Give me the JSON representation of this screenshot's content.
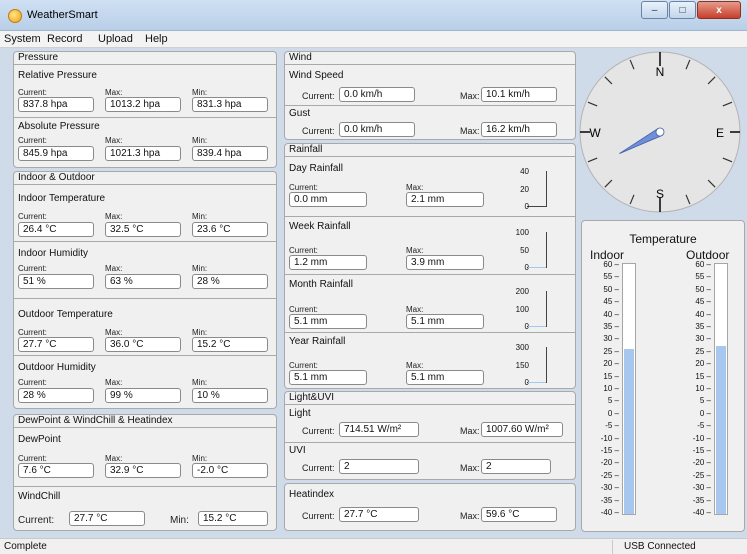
{
  "window": {
    "title": "WeatherSmart",
    "minimize": "–",
    "maximize": "□",
    "close": "x"
  },
  "menu": [
    "System",
    "Record",
    "Upload",
    "Help"
  ],
  "labels": {
    "current": "Current:",
    "max": "Max:",
    "min": "Min:"
  },
  "pressure": {
    "title": "Pressure",
    "relative": {
      "title": "Relative Pressure",
      "current": "837.8 hpa",
      "max": "1013.2 hpa",
      "min": "831.3 hpa"
    },
    "absolute": {
      "title": "Absolute Pressure",
      "current": "845.9 hpa",
      "max": "1021.3 hpa",
      "min": "839.4 hpa"
    }
  },
  "indoor_outdoor": {
    "title": "Indoor & Outdoor",
    "indoor_temp": {
      "title": "Indoor Temperature",
      "current": "26.4 °C",
      "max": "32.5 °C",
      "min": "23.6 °C"
    },
    "indoor_humidity": {
      "title": "Indoor Humidity",
      "current": "51 %",
      "max": "63 %",
      "min": "28 %"
    },
    "outdoor_temp": {
      "title": "Outdoor Temperature",
      "current": "27.7 °C",
      "max": "36.0 °C",
      "min": "15.2 °C"
    },
    "outdoor_humidity": {
      "title": "Outdoor Humidity",
      "current": "28 %",
      "max": "99 %",
      "min": "10 %"
    }
  },
  "dewpoint": {
    "title": "DewPoint & WindChill & Heatindex",
    "dew": {
      "title": "DewPoint",
      "current": "7.6 °C",
      "max": "32.9 °C",
      "min": "-2.0 °C"
    },
    "windchill": {
      "title": "WindChill",
      "current_label": "Current:",
      "current": "27.7 °C",
      "min_label": "Min:",
      "min": "15.2 °C"
    }
  },
  "wind": {
    "title": "Wind",
    "speed": {
      "title": "Wind Speed",
      "current": "0.0 km/h",
      "max": "10.1 km/h"
    },
    "gust": {
      "title": "Gust",
      "current": "0.0 km/h",
      "max": "16.2 km/h"
    }
  },
  "rainfall": {
    "title": "Rainfall",
    "day": {
      "title": "Day Rainfall",
      "current": "0.0 mm",
      "max": "2.1 mm",
      "ticks": [
        "40",
        "20",
        "0"
      ],
      "level": 0.0
    },
    "week": {
      "title": "Week Rainfall",
      "current": "1.2 mm",
      "max": "3.9 mm",
      "ticks": [
        "100",
        "50",
        "0"
      ],
      "level": 0.012
    },
    "month": {
      "title": "Month Rainfall",
      "current": "5.1 mm",
      "max": "5.1 mm",
      "ticks": [
        "200",
        "100",
        "0"
      ],
      "level": 0.025
    },
    "year": {
      "title": "Year Rainfall",
      "current": "5.1 mm",
      "max": "5.1 mm",
      "ticks": [
        "300",
        "150",
        "0"
      ],
      "level": 0.017
    }
  },
  "light_uvi": {
    "title": "Light&UVI",
    "light": {
      "title": "Light",
      "current": "714.51 W/m²",
      "max": "1007.60 W/m²"
    },
    "uvi": {
      "title": "UVI",
      "current": "2",
      "max": "2"
    }
  },
  "heatindex": {
    "title": "Heatindex",
    "current": "27.7 °C",
    "max": "59.6 °C"
  },
  "compass": {
    "n": "N",
    "e": "E",
    "s": "S",
    "w": "W",
    "direction_deg": 242
  },
  "temperature": {
    "title": "Temperature",
    "indoor_label": "Indoor",
    "outdoor_label": "Outdoor",
    "scale": [
      "60",
      "55",
      "50",
      "45",
      "40",
      "35",
      "30",
      "25",
      "20",
      "15",
      "10",
      "5",
      "0",
      "-5",
      "-10",
      "-15",
      "-20",
      "-25",
      "-30",
      "-35",
      "-40"
    ],
    "indoor_value": 26.4,
    "outdoor_value": 27.7
  },
  "status": {
    "left": "Complete",
    "right": "USB Connected"
  },
  "colors": {
    "fill": "#a7c7ef",
    "needle": "#6f8fd8"
  }
}
